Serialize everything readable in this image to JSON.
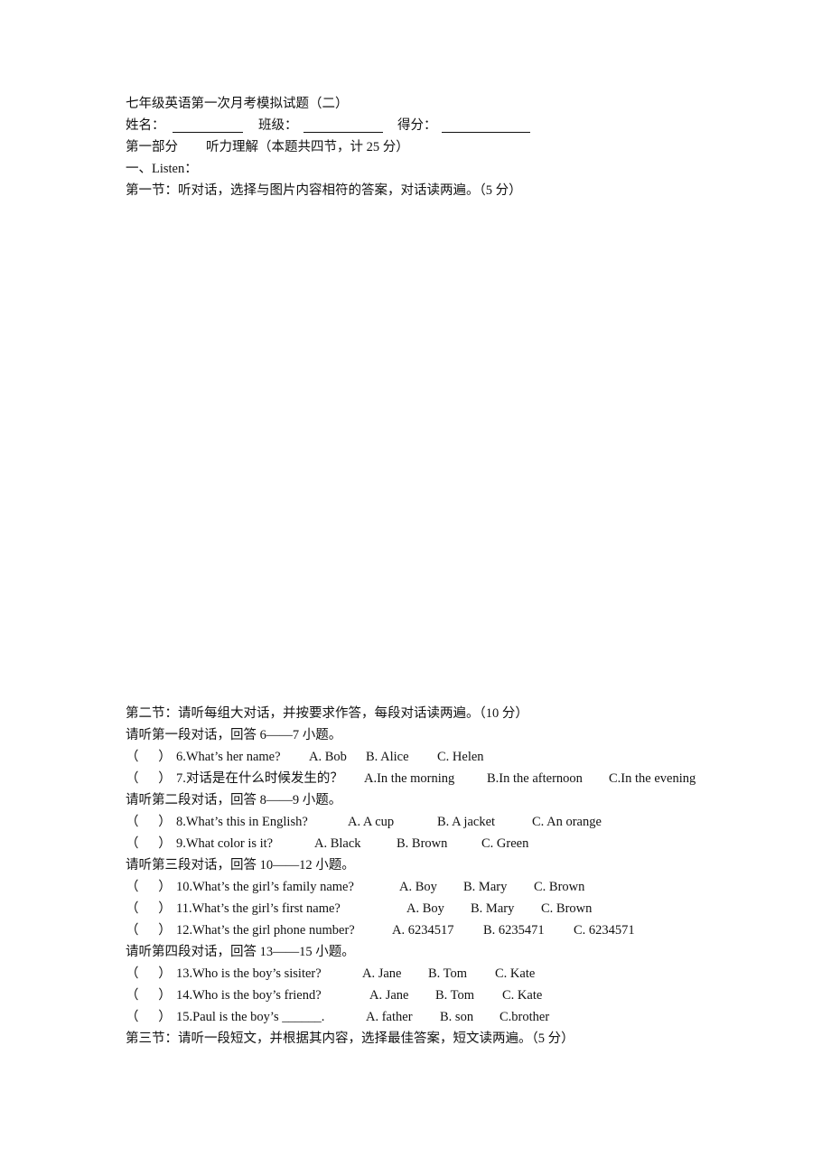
{
  "title": "七年级英语第一次月考模拟试题（二）",
  "header_fields": [
    {
      "label": "姓名：",
      "value": ""
    },
    {
      "label": "班级：",
      "value": ""
    },
    {
      "label": "得分：",
      "value": ""
    }
  ],
  "part1": {
    "label": "第一部分",
    "title": "听力理解（本题共四节，计 25 分）"
  },
  "listen_heading": "一、Listen：",
  "section1": {
    "heading": "第一节：听对话，选择与图片内容相符的答案，对话读两遍。（5 分）"
  },
  "section2": {
    "heading": "第二节：请听每组大对话，并按要求作答，每段对话读两遍。（10 分）",
    "groups": [
      {
        "intro": "请听第一段对话，回答 6——7 小题。",
        "questions": [
          {
            "paren": "（      ）",
            "text": "6.What’s her name?",
            "options": [
              "A. Bob",
              "B. Alice",
              "C. Helen"
            ]
          },
          {
            "paren": "（      ）",
            "text": "7.对话是在什么时候发生的？",
            "options": [
              "A.In the morning",
              "B.In the afternoon",
              "C.In the evening"
            ]
          }
        ]
      },
      {
        "intro": "请听第二段对话，回答 8——9 小题。",
        "questions": [
          {
            "paren": "（      ）",
            "text": "8.What’s this in English?",
            "options": [
              "A. A cup",
              "B. A jacket",
              "C. An orange"
            ]
          },
          {
            "paren": "（      ）",
            "text": "9.What color is it?",
            "options": [
              "A. Black",
              "B. Brown",
              "C. Green"
            ]
          }
        ]
      },
      {
        "intro": "请听第三段对话，回答 10——12 小题。",
        "questions": [
          {
            "paren": "（      ）",
            "text": "10.What’s the girl’s family name?",
            "options": [
              "A. Boy",
              "B. Mary",
              "C. Brown"
            ]
          },
          {
            "paren": "（      ）",
            "text": "11.What’s the girl’s first name?",
            "options": [
              "A. Boy",
              "B. Mary",
              "C. Brown"
            ]
          },
          {
            "paren": "（      ）",
            "text": "12.What’s the girl phone number?",
            "options": [
              "A. 6234517",
              "B. 6235471",
              "C. 6234571"
            ]
          }
        ]
      },
      {
        "intro": "请听第四段对话，回答 13——15 小题。",
        "questions": [
          {
            "paren": "（      ）",
            "text": "13.Who is the boy’s sisiter?",
            "options": [
              "A. Jane",
              "B. Tom",
              "C. Kate"
            ]
          },
          {
            "paren": "（      ）",
            "text": "14.Who is the boy’s friend?",
            "options": [
              "A. Jane",
              "B. Tom",
              "C. Kate"
            ]
          },
          {
            "paren": "（      ）",
            "text": "15.Paul is the boy’s ______.",
            "options": [
              "A. father",
              "B. son",
              "C.brother"
            ]
          }
        ]
      }
    ]
  },
  "section3": {
    "heading": "第三节：请听一段短文，并根据其内容，选择最佳答案，短文读两遍。（5 分）"
  }
}
